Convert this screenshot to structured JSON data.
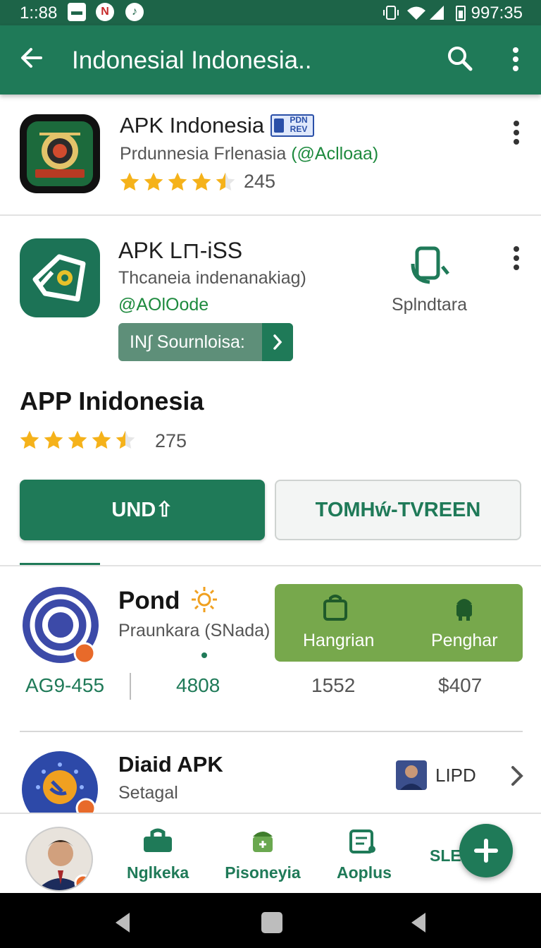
{
  "status_bar": {
    "time": "1::88",
    "clock": "997:35"
  },
  "app_bar": {
    "title": "Indonesial Indonesia.."
  },
  "items": [
    {
      "name": "APK Indonesia",
      "badge": "PDN REV",
      "developer": "Prdunnesia Frlenasia",
      "developer_handle": "(@Aclloaa)",
      "rating": 4.5,
      "rating_count": "245"
    },
    {
      "name": "APK L⊓-iSS",
      "description": "Thcaneia indenanakiag)",
      "developer": "@AOlOode",
      "side_label": "Splndtara",
      "source_button": "IN︎∫ Sournloisa:"
    }
  ],
  "featured": {
    "title": "APP Inidonesia",
    "rating": 4.5,
    "rating_count": "275",
    "primary_button": "UND⇧",
    "secondary_button": "TOMHẃ-TVREEN"
  },
  "pond": {
    "name": "Pond",
    "description": "Praunkara (SNada)",
    "panel": {
      "left_label": "Hangrian",
      "right_label": "Penghar"
    },
    "stats": [
      "AG9-455",
      "4808",
      "1552",
      "$407"
    ]
  },
  "diaid": {
    "name": "Diaid APK",
    "description": "Setagal",
    "side_label": "LIPD"
  },
  "bottom_nav": {
    "items": [
      "Nglkeka",
      "Pisoneyia",
      "Aoplus"
    ],
    "partial": "SLE    S"
  },
  "colors": {
    "primary": "#1f7a58",
    "status_bar": "#1d6448",
    "panel_green": "#77a84c",
    "star": "#f5b21a"
  }
}
